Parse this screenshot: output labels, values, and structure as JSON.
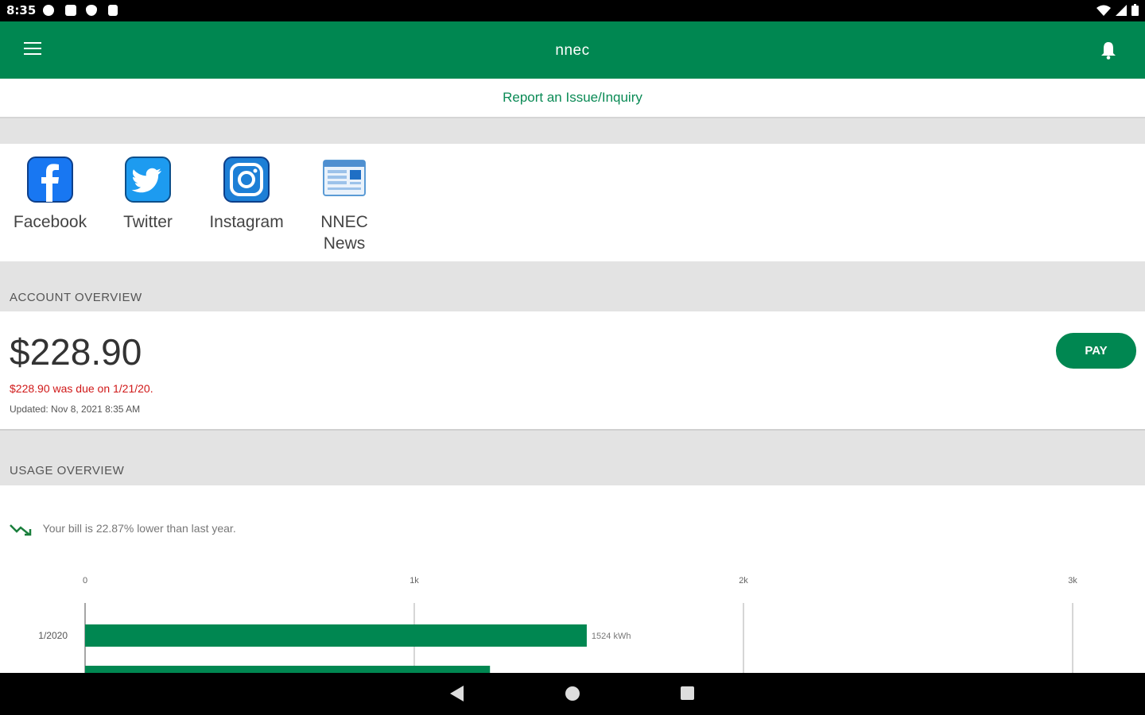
{
  "status_bar": {
    "time": "8:35"
  },
  "app_bar": {
    "title": "nnec"
  },
  "report": {
    "label": "Report an Issue/Inquiry"
  },
  "social": {
    "facebook": "Facebook",
    "twitter": "Twitter",
    "instagram": "Instagram",
    "news_line1": "NNEC",
    "news_line2": "News"
  },
  "account": {
    "section_title": "ACCOUNT OVERVIEW",
    "amount": "$228.90",
    "due_text": "$228.90 was due on 1/21/20.",
    "updated_text": "Updated: Nov 8, 2021 8:35 AM",
    "pay_label": "PAY"
  },
  "usage": {
    "section_title": "USAGE OVERVIEW",
    "trend_text": "Your bill is 22.87% lower than last year."
  },
  "colors": {
    "brand_green": "#008751",
    "due_red": "#d01818"
  },
  "chart_data": {
    "type": "bar",
    "orientation": "horizontal",
    "x_ticks": [
      "0",
      "1k",
      "2k",
      "3k"
    ],
    "xlim": [
      0,
      3000
    ],
    "categories": [
      "1/2020",
      ""
    ],
    "values": [
      1524,
      1230
    ],
    "data_labels": [
      "1524 kWh",
      ""
    ],
    "grid": true
  }
}
